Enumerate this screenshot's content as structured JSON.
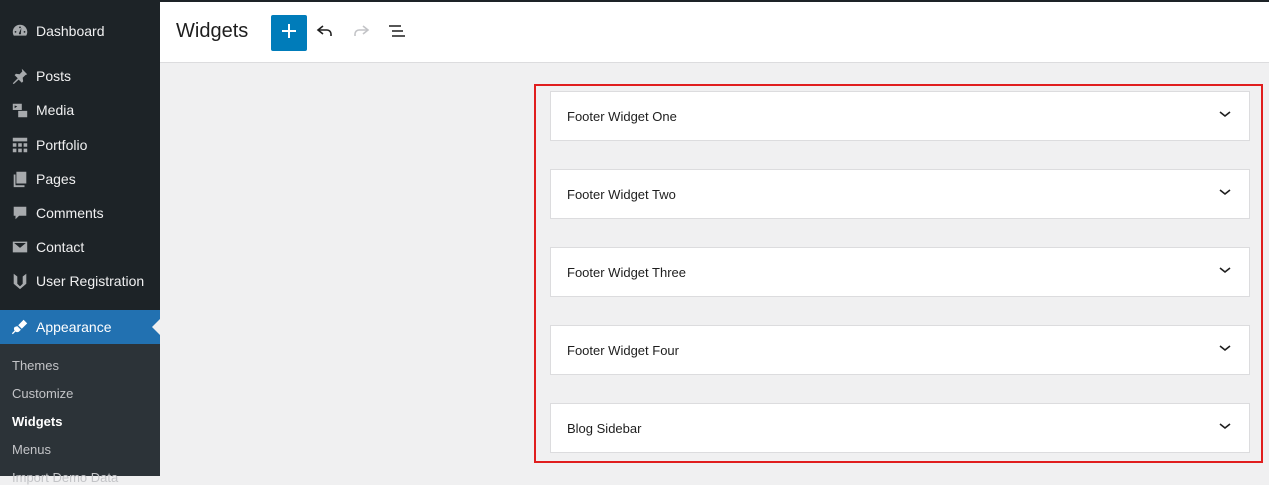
{
  "sidebar": {
    "items": [
      {
        "label": "Dashboard",
        "icon": "dashboard-icon"
      },
      {
        "label": "Posts",
        "icon": "pin-icon"
      },
      {
        "label": "Media",
        "icon": "media-icon"
      },
      {
        "label": "Portfolio",
        "icon": "grid-icon"
      },
      {
        "label": "Pages",
        "icon": "pages-icon"
      },
      {
        "label": "Comments",
        "icon": "comment-icon"
      },
      {
        "label": "Contact",
        "icon": "mail-icon"
      },
      {
        "label": "User Registration",
        "icon": "user-registration-icon"
      },
      {
        "label": "Appearance",
        "icon": "paintbrush-icon"
      }
    ],
    "submenu": [
      "Themes",
      "Customize",
      "Widgets",
      "Menus",
      "Import Demo Data"
    ],
    "active_color": "#2271b1"
  },
  "header": {
    "title": "Widgets",
    "add_icon": "plus-icon",
    "undo_icon": "undo-icon",
    "redo_icon": "redo-icon",
    "list_view_icon": "list-view-icon"
  },
  "widget_areas": [
    {
      "title": "Footer Widget One"
    },
    {
      "title": "Footer Widget Two"
    },
    {
      "title": "Footer Widget Three"
    },
    {
      "title": "Footer Widget Four"
    },
    {
      "title": "Blog Sidebar"
    }
  ],
  "highlight_color": "#e01e1e"
}
